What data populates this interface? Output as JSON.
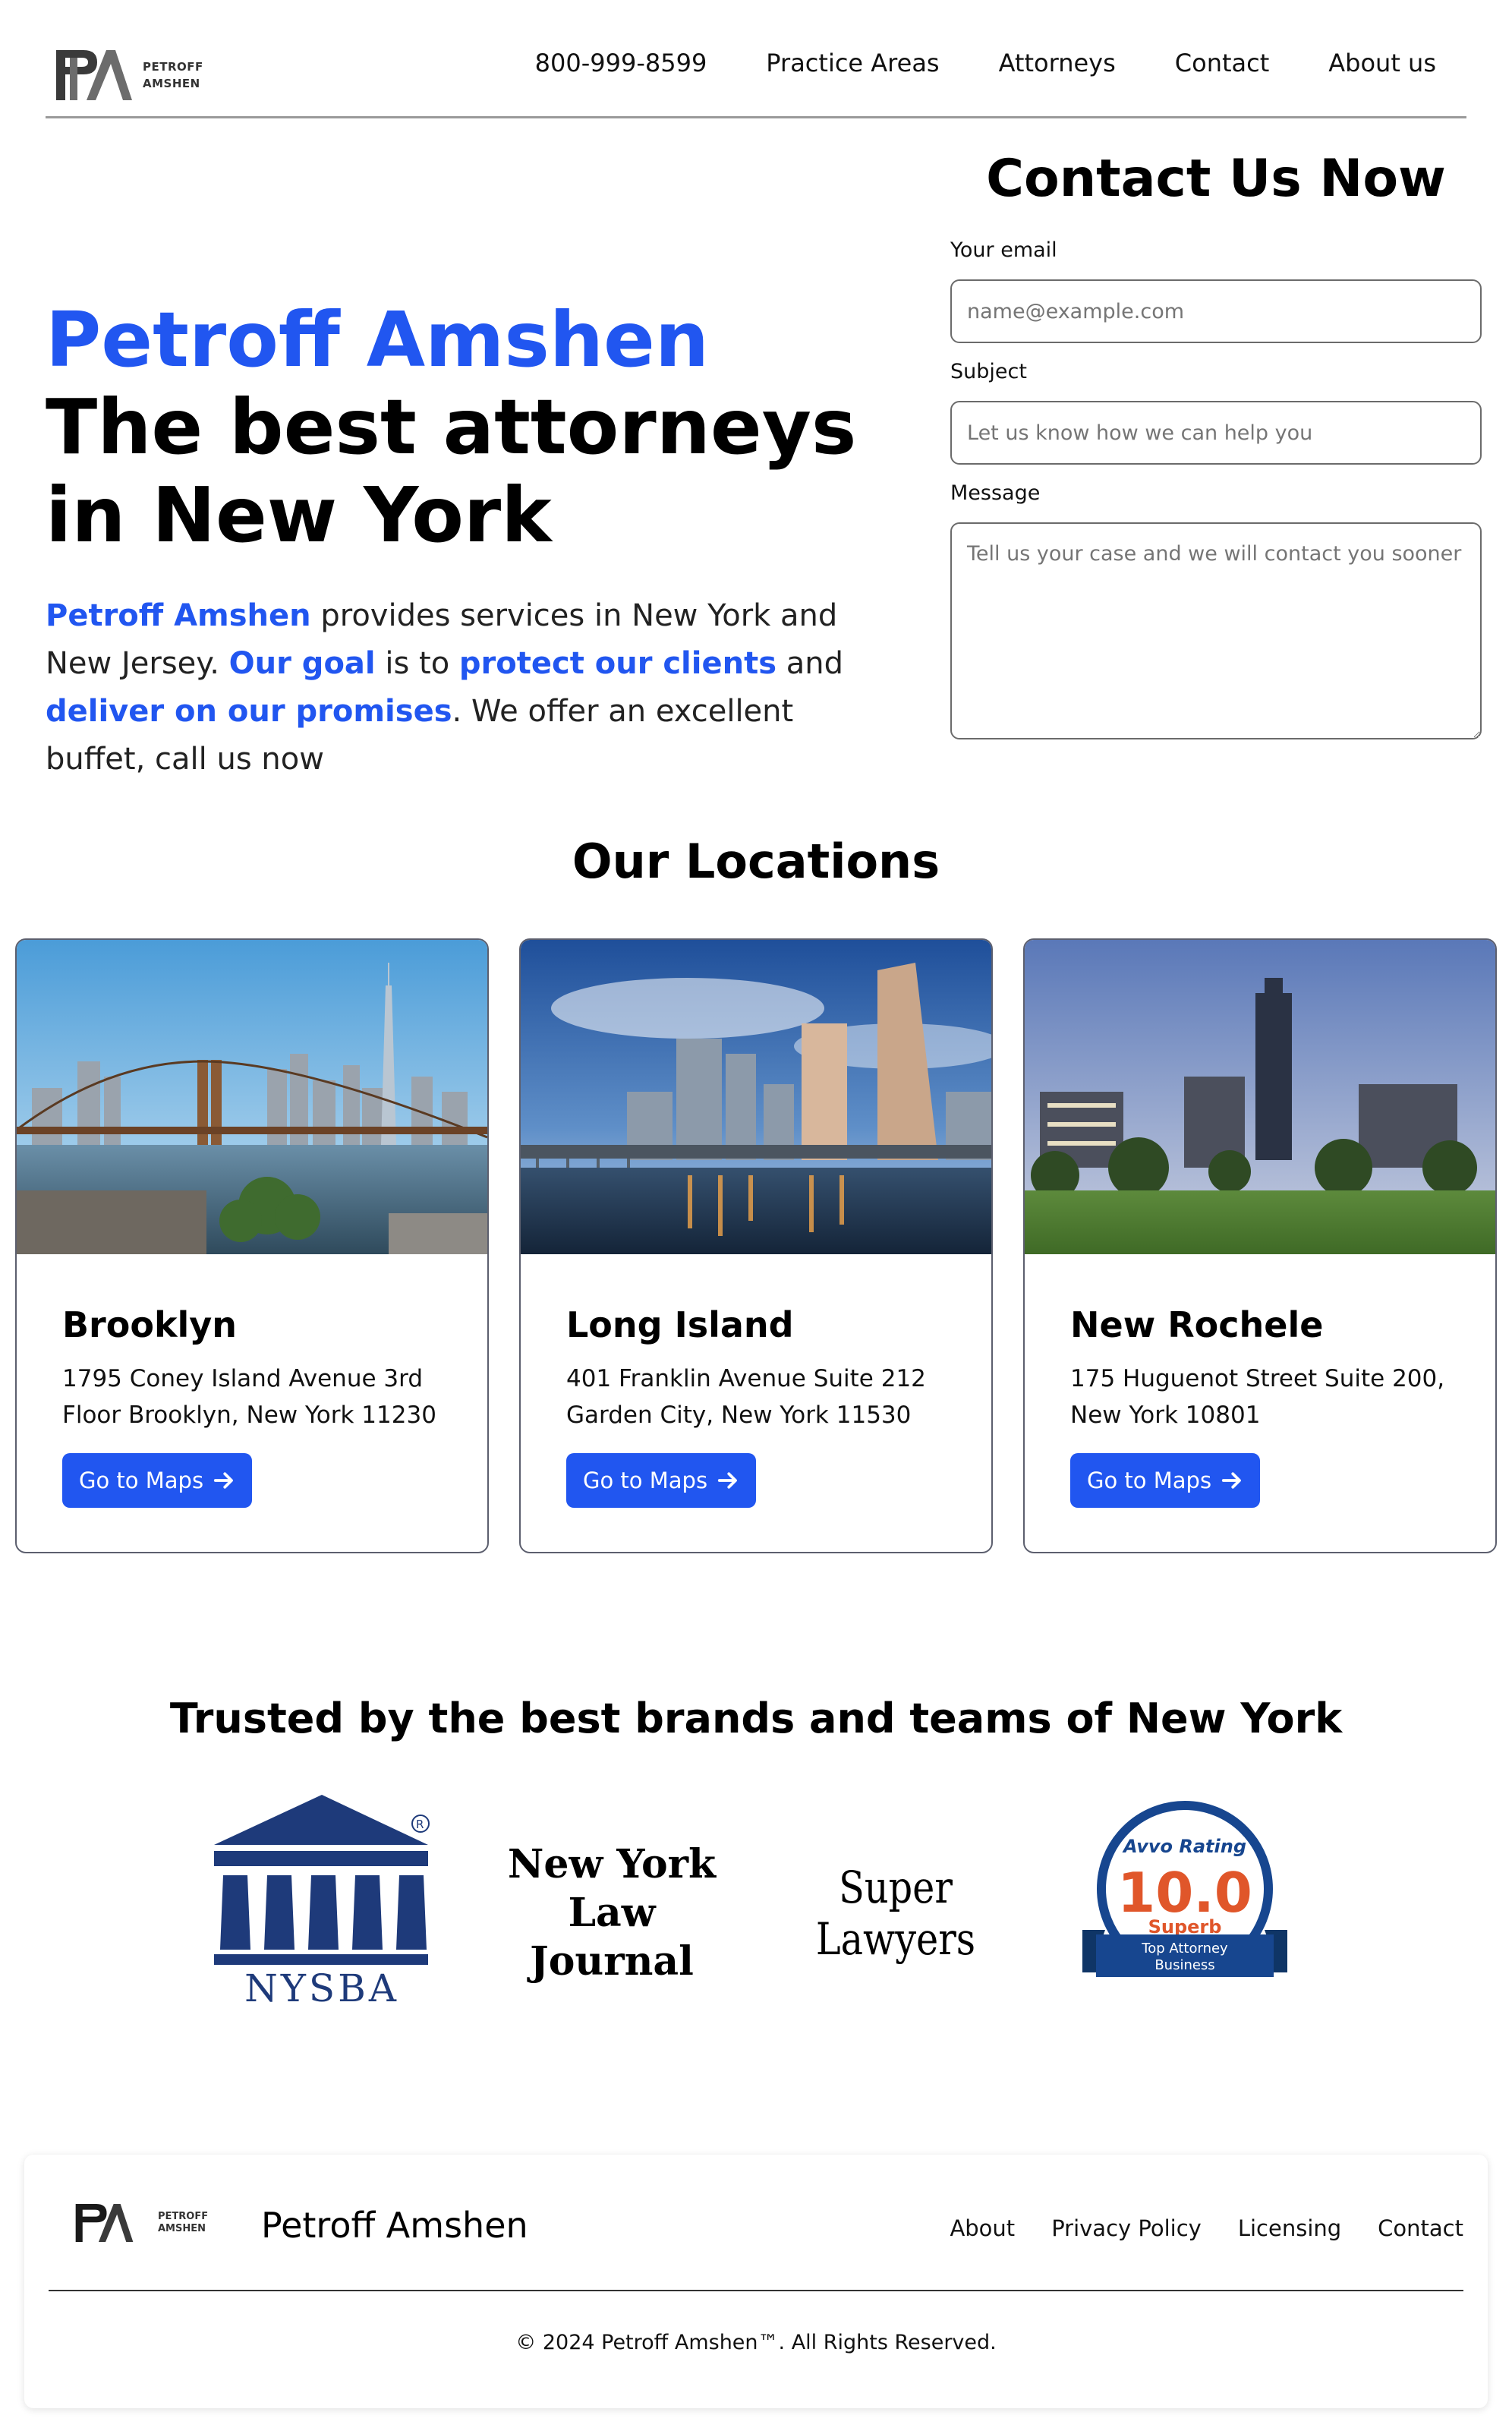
{
  "header": {
    "logo_line1": "PETROFF",
    "logo_line2": "AMSHEN",
    "nav": [
      "800-999-8599",
      "Practice Areas",
      "Attorneys",
      "Contact",
      "About us"
    ]
  },
  "hero": {
    "brand": "Petroff Amshen",
    "title_line1": "The best attorneys",
    "title_line2": "in New York",
    "desc_1": "Petroff Amshen",
    "desc_2": " provides services in New York and New Jersey. ",
    "desc_3": "Our goal",
    "desc_4": " is to ",
    "desc_5": "protect our clients",
    "desc_6": " and ",
    "desc_7": "deliver on our promises",
    "desc_8": ". We offer an excellent buffet, call us now"
  },
  "contact": {
    "title": "Contact Us Now",
    "email_label": "Your email",
    "email_placeholder": "name@example.com",
    "subject_label": "Subject",
    "subject_placeholder": "Let us know how we can help you",
    "message_label": "Message",
    "message_placeholder": "Tell us your case and we will contact you sooner"
  },
  "locations": {
    "title": "Our Locations",
    "button_label": "Go to Maps",
    "items": [
      {
        "name": "Brooklyn",
        "address": "1795 Coney Island Avenue 3rd Floor Brooklyn, New York 11230"
      },
      {
        "name": "Long Island",
        "address": "401 Franklin Avenue Suite 212 Garden City, New York 11530"
      },
      {
        "name": "New Rochele",
        "address": "175 Huguenot Street Suite 200, New York 10801"
      }
    ]
  },
  "brands": {
    "title": "Trusted by the best brands and teams of New York",
    "nysba": "NYSBA",
    "nylj_1": "New York",
    "nylj_2": "Law Journal",
    "super_lawyers": "Super Lawyers",
    "avvo_brand": "Avvo Rating",
    "avvo_score": "10.0",
    "avvo_grade": "Superb",
    "avvo_ribbon_1": "Top Attorney",
    "avvo_ribbon_2": "Business"
  },
  "footer": {
    "logo_line1": "PETROFF",
    "logo_line2": "AMSHEN",
    "brand": "Petroff Amshen",
    "links": [
      "About",
      "Privacy Policy",
      "Licensing",
      "Contact"
    ],
    "copyright": "© 2024 Petroff Amshen™. All Rights Reserved."
  },
  "colors": {
    "accent": "#2156f0",
    "nysba_navy": "#1e3a7a",
    "avvo_blue": "#17468f",
    "avvo_orange": "#e0562a"
  }
}
